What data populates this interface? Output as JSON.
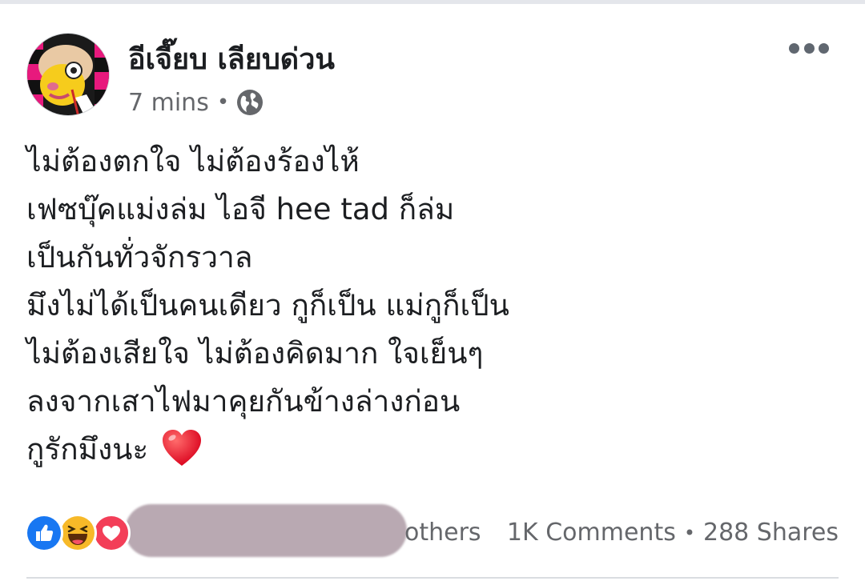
{
  "post": {
    "author": "อีเจี๊ยบ เลียบด่วน",
    "time": "7 mins",
    "privacy_icon": "globe-icon",
    "more_icon": "more-horizontal-icon",
    "content_lines": [
      "ไม่ต้องตกใจ ไม่ต้องร้องไห้",
      "เฟซบุ๊คแม่งล่ม ไอจี hee tad ก็ล่ม",
      "เป็นกันทั่วจักรวาล",
      "มึงไม่ได้เป็นคนเดียว กูก็เป็น แม่กูก็เป็น",
      "ไม่ต้องเสียใจ ไม่ต้องคิดมาก ใจเย็นๆ",
      "ลงจากเสาไฟมาคุยกันข้างล่างก่อน",
      "กูรักมึงนะ"
    ],
    "content_emoji": "red-heart-icon"
  },
  "footer": {
    "reaction_icons": [
      "like-icon",
      "haha-icon",
      "love-icon"
    ],
    "reaction_others": "others",
    "comments": "1K Comments",
    "shares": "288 Shares",
    "separator": "•"
  },
  "colors": {
    "like": "#1877f2",
    "haha": "#f7b928",
    "love": "#f33e58",
    "secondary_text": "#65676b",
    "redaction": "#b9a9b2"
  }
}
